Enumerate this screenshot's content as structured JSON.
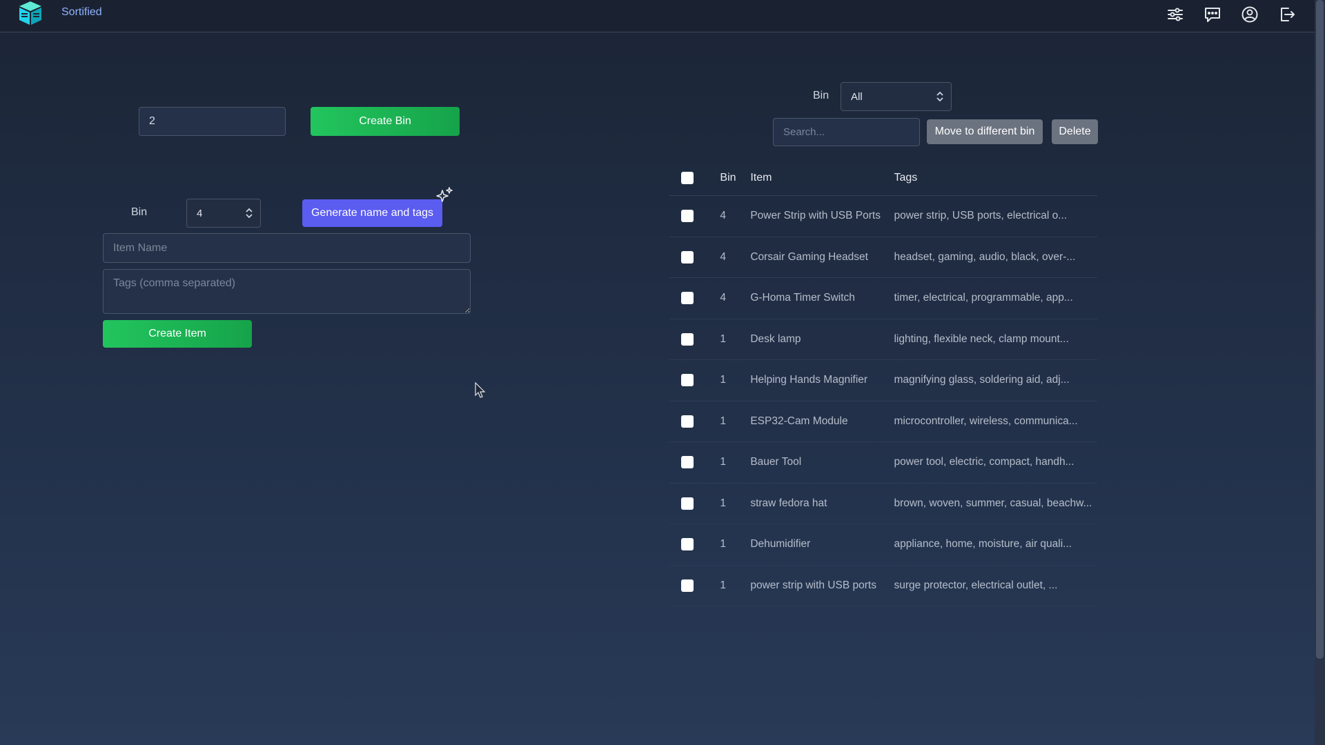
{
  "header": {
    "app_title": "Sortified",
    "icons": [
      "sliders-icon",
      "chat-icon",
      "user-circle-icon",
      "logout-icon"
    ]
  },
  "create_bin": {
    "bin_number_value": "2",
    "button_label": "Create Bin"
  },
  "create_item": {
    "bin_label": "Bin",
    "bin_selected": "4",
    "generate_button_label": "Generate name and tags",
    "item_name_placeholder": "Item Name",
    "tags_placeholder": "Tags (comma separated)",
    "button_label": "Create Item"
  },
  "filter": {
    "bin_label": "Bin",
    "bin_selected": "All",
    "search_placeholder": "Search...",
    "move_button_label": "Move to different bin",
    "delete_button_label": "Delete"
  },
  "table": {
    "headers": {
      "bin": "Bin",
      "item": "Item",
      "tags": "Tags"
    },
    "rows": [
      {
        "bin": "4",
        "item": "Power Strip with USB Ports",
        "tags": "power strip, USB ports, electrical o..."
      },
      {
        "bin": "4",
        "item": "Corsair Gaming Headset",
        "tags": "headset, gaming, audio, black, over-..."
      },
      {
        "bin": "4",
        "item": "G-Homa Timer Switch",
        "tags": "timer, electrical, programmable, app..."
      },
      {
        "bin": "1",
        "item": "Desk lamp",
        "tags": "lighting, flexible neck, clamp mount..."
      },
      {
        "bin": "1",
        "item": "Helping Hands Magnifier",
        "tags": "magnifying glass, soldering aid, adj..."
      },
      {
        "bin": "1",
        "item": "ESP32-Cam Module",
        "tags": "microcontroller, wireless, communica..."
      },
      {
        "bin": "1",
        "item": "Bauer Tool",
        "tags": "power tool, electric, compact, handh..."
      },
      {
        "bin": "1",
        "item": "straw fedora hat",
        "tags": "brown, woven, summer, casual, beachw..."
      },
      {
        "bin": "1",
        "item": "Dehumidifier",
        "tags": "appliance, home, moisture, air quali..."
      },
      {
        "bin": "1",
        "item": "power strip with USB ports",
        "tags": "surge protector, electrical outlet, ..."
      }
    ]
  },
  "colors": {
    "accent_green": "#22c55e",
    "accent_purple": "#5b5cf0",
    "brand_teal": "#22d3ee",
    "button_grey": "#6b7280"
  }
}
